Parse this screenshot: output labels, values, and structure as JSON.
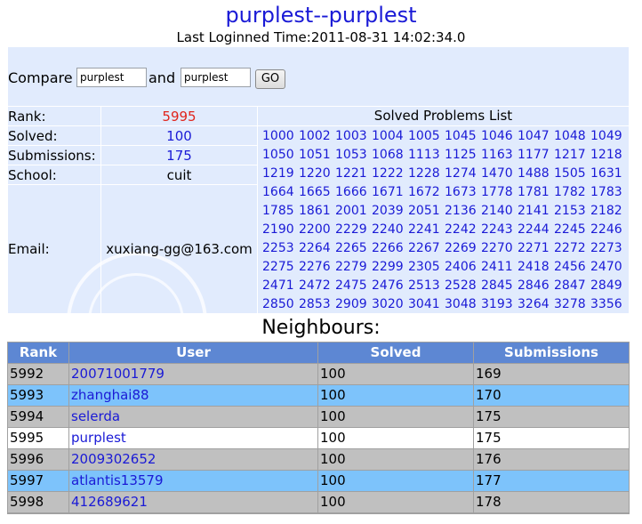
{
  "header": {
    "title": "purplest--purplest",
    "last_login": "Last Loginned Time:2011-08-31 14:02:34.0"
  },
  "compare": {
    "label": "Compare",
    "user1": "purplest",
    "and_label": "and",
    "user2": "purplest",
    "go_label": "GO"
  },
  "stats": [
    {
      "label": "Rank:",
      "value": "5995"
    },
    {
      "label": "Solved:",
      "value": "100"
    },
    {
      "label": "Submissions:",
      "value": "175"
    },
    {
      "label": "School:",
      "value": "cuit"
    },
    {
      "label": "Email:",
      "value": "xuxiang-gg@163.com"
    }
  ],
  "colors": {
    "rank": "#e0251c",
    "link": "#1a1ad6",
    "header_bg": "#5d87d3",
    "panel_bg": "#e1ebfd"
  },
  "solved_list": {
    "title": "Solved Problems List",
    "problems": [
      "1000",
      "1002",
      "1003",
      "1004",
      "1005",
      "1045",
      "1046",
      "1047",
      "1048",
      "1049",
      "1050",
      "1051",
      "1053",
      "1068",
      "1113",
      "1125",
      "1163",
      "1177",
      "1217",
      "1218",
      "1219",
      "1220",
      "1221",
      "1222",
      "1228",
      "1274",
      "1470",
      "1488",
      "1505",
      "1631",
      "1664",
      "1665",
      "1666",
      "1671",
      "1672",
      "1673",
      "1778",
      "1781",
      "1782",
      "1783",
      "1785",
      "1861",
      "2001",
      "2039",
      "2051",
      "2136",
      "2140",
      "2141",
      "2153",
      "2182",
      "2190",
      "2200",
      "2229",
      "2240",
      "2241",
      "2242",
      "2243",
      "2244",
      "2245",
      "2246",
      "2253",
      "2264",
      "2265",
      "2266",
      "2267",
      "2269",
      "2270",
      "2271",
      "2272",
      "2273",
      "2275",
      "2276",
      "2279",
      "2299",
      "2305",
      "2406",
      "2411",
      "2418",
      "2456",
      "2470",
      "2471",
      "2472",
      "2475",
      "2476",
      "2513",
      "2528",
      "2845",
      "2846",
      "2847",
      "2849",
      "2850",
      "2853",
      "2909",
      "3020",
      "3041",
      "3048",
      "3193",
      "3264",
      "3278",
      "3356"
    ]
  },
  "neighbours": {
    "title": "Neighbours:",
    "columns": [
      "Rank",
      "User",
      "Solved",
      "Submissions"
    ],
    "rows": [
      {
        "rank": "5992",
        "user": "20071001779",
        "solved": "100",
        "submissions": "169",
        "bg": "#c0c0c0"
      },
      {
        "rank": "5993",
        "user": "zhanghai88",
        "solved": "100",
        "submissions": "170",
        "bg": "#7dc3fb"
      },
      {
        "rank": "5994",
        "user": "selerda",
        "solved": "100",
        "submissions": "175",
        "bg": "#c0c0c0"
      },
      {
        "rank": "5995",
        "user": "purplest",
        "solved": "100",
        "submissions": "175",
        "bg": "#ffffff"
      },
      {
        "rank": "5996",
        "user": "2009302652",
        "solved": "100",
        "submissions": "176",
        "bg": "#c0c0c0"
      },
      {
        "rank": "5997",
        "user": "atlantis13579",
        "solved": "100",
        "submissions": "177",
        "bg": "#7dc3fb"
      },
      {
        "rank": "5998",
        "user": "412689621",
        "solved": "100",
        "submissions": "178",
        "bg": "#c0c0c0"
      }
    ]
  }
}
